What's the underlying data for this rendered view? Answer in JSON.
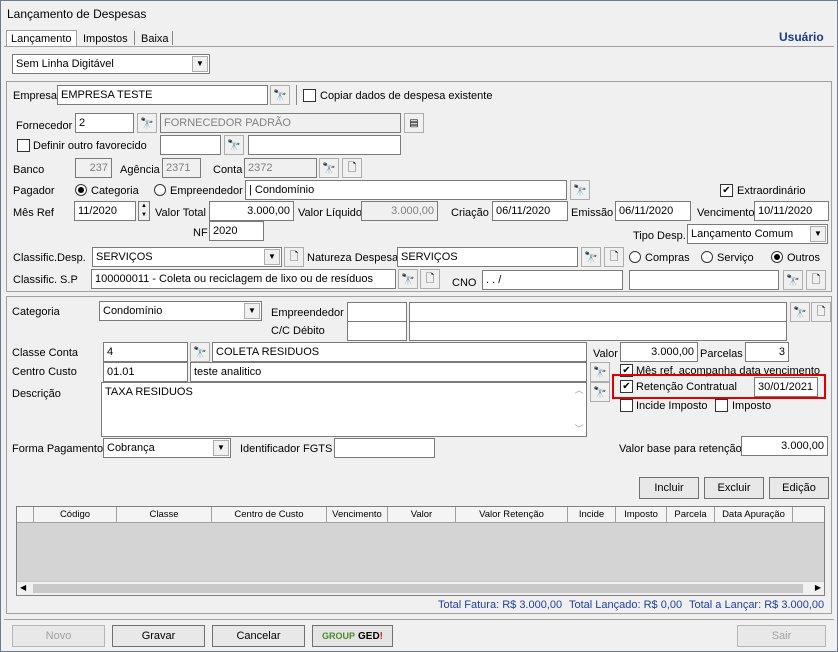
{
  "window": {
    "title": "Lançamento de Despesas",
    "user_label": "Usuário"
  },
  "tabs": [
    {
      "label": "Lançamento",
      "active": true
    },
    {
      "label": "Impostos",
      "active": false
    },
    {
      "label": "Baixa",
      "active": false
    }
  ],
  "linha_digitavel": {
    "selected": "Sem Linha Digitável"
  },
  "top": {
    "empresa_label": "Empresa",
    "empresa": "EMPRESA TESTE",
    "copiar_label": "Copiar dados de despesa existente",
    "fornecedor_label": "Fornecedor",
    "fornecedor_code": "2",
    "fornecedor_name": "FORNECEDOR PADRÃO",
    "favorecido_label": "Definir outro favorecido",
    "banco_label": "Banco",
    "banco": "237",
    "agencia_label": "Agência",
    "agencia": "2371",
    "conta_label": "Conta",
    "conta": "2372",
    "pagador_label": "Pagador",
    "categoria_radio": "Categoria",
    "empreendedor_radio": "Empreendedor",
    "pagador_value": "| Condomínio",
    "extraordinario_label": "Extraordinário",
    "mesref_label": "Mês Ref",
    "mesref": "11/2020",
    "valortotal_label": "Valor Total",
    "valortotal": "3.000,00",
    "valorliquido_label": "Valor Líquido",
    "valorliquido": "3.000,00",
    "criacao_label": "Criação",
    "criacao": "06/11/2020",
    "emissao_label": "Emissão",
    "emissao": "06/11/2020",
    "vencimento_label": "Vencimento",
    "vencimento": "10/11/2020",
    "nf_label": "NF",
    "nf": "2020",
    "tipodesp_label": "Tipo Desp.",
    "tipodesp": "Lançamento Comum",
    "classif_label": "Classific.Desp.",
    "classif": "SERVIÇOS",
    "natureza_label": "Natureza Despesa",
    "natureza": "SERVIÇOS",
    "compras_label": "Compras",
    "servico_label": "Serviço",
    "outros_label": "Outros",
    "classifsp_label": "Classific. S.P",
    "classifsp": "100000011 - Coleta ou reciclagem de lixo ou de resíduos",
    "cno_label": "CNO",
    "cno": " .   .     /"
  },
  "bottom": {
    "categoria_label": "Categoria",
    "categoria": "Condomínio",
    "empreendedor_label": "Empreendedor",
    "ccdebito_label": "C/C Débito",
    "classeconta_label": "Classe Conta",
    "classeconta_code": "4",
    "classeconta_name": "COLETA RESIDUOS",
    "valor_label": "Valor",
    "valor": "3.000,00",
    "parcelas_label": "Parcelas",
    "parcelas": "3",
    "centrocusto_label": "Centro Custo",
    "centrocusto_code": "01.01",
    "centrocusto_name": "teste analitico",
    "mesref_acomp_label": "Mês ref. acompanha data vencimento",
    "descricao_label": "Descrição",
    "descricao": "TAXA RESIDUOS",
    "retencao_label": "Retenção Contratual",
    "retencao_date": "30/01/2021",
    "incide_label": "Incide Imposto",
    "imposto_label": "Imposto",
    "formapag_label": "Forma Pagamento",
    "formapag": "Cobrança",
    "fgts_label": "Identificador FGTS",
    "valorbase_label": "Valor base para retenção",
    "valorbase": "3.000,00",
    "incluir": "Incluir",
    "excluir": "Excluir",
    "edicao": "Edição"
  },
  "grid": {
    "columns": [
      "Código",
      "Classe",
      "Centro de Custo",
      "Vencimento",
      "Valor",
      "Valor Retenção",
      "Incide",
      "Imposto",
      "Parcela",
      "Data Apuração"
    ]
  },
  "totals": {
    "fatura": "Total Fatura: R$ 3.000,00",
    "lancado": "Total Lançado: R$ 0,00",
    "alancar": "Total a Lançar: R$ 3.000,00"
  },
  "footer": {
    "novo": "Novo",
    "gravar": "Gravar",
    "cancelar": "Cancelar",
    "ged_group": "GROUP",
    "ged_brand": "GED",
    "ged_bang": "!",
    "sair": "Sair"
  },
  "colors": {
    "highlight": "#e00000",
    "accent_blue": "#1a3a8a",
    "totals_blue": "#1f3f9f"
  }
}
